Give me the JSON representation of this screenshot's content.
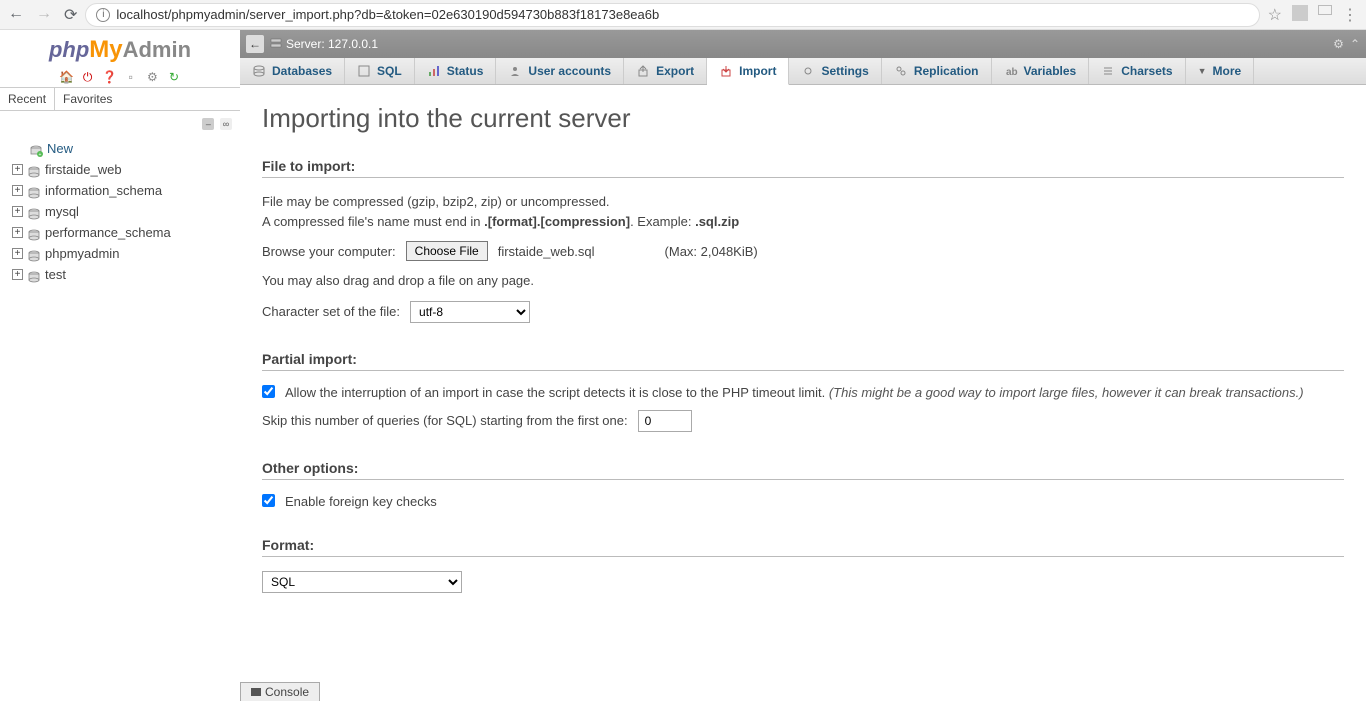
{
  "browser": {
    "url": "localhost/phpmyadmin/server_import.php?db=&token=02e630190d594730b883f18173e8ea6b"
  },
  "logo": {
    "part1": "php",
    "part2": "My",
    "part3": "Admin"
  },
  "sidebar": {
    "recent": "Recent",
    "favorites": "Favorites",
    "new": "New",
    "databases": [
      "firstaide_web",
      "information_schema",
      "mysql",
      "performance_schema",
      "phpmyadmin",
      "test"
    ]
  },
  "server_bar": {
    "label": "Server: 127.0.0.1"
  },
  "tabs": [
    "Databases",
    "SQL",
    "Status",
    "User accounts",
    "Export",
    "Import",
    "Settings",
    "Replication",
    "Variables",
    "Charsets",
    "More"
  ],
  "page": {
    "title": "Importing into the current server",
    "file_to_import": "File to import:",
    "compress_hint1": "File may be compressed (gzip, bzip2, zip) or uncompressed.",
    "compress_hint2a": "A compressed file's name must end in ",
    "compress_hint2b": ".[format].[compression]",
    "compress_hint2c": ". Example: ",
    "compress_hint2d": ".sql.zip",
    "browse_label": "Browse your computer:",
    "choose_file": "Choose File",
    "chosen_file": "firstaide_web.sql",
    "max_size": "(Max: 2,048KiB)",
    "dragdrop": "You may also drag and drop a file on any page.",
    "charset_label": "Character set of the file:",
    "charset_value": "utf-8",
    "partial_import": "Partial import:",
    "allow_interrupt": "Allow the interruption of an import in case the script detects it is close to the PHP timeout limit. ",
    "allow_interrupt_hint": "(This might be a good way to import large files, however it can break transactions.)",
    "skip_label": "Skip this number of queries (for SQL) starting from the first one:",
    "skip_value": "0",
    "other_options": "Other options:",
    "fk_checks": "Enable foreign key checks",
    "format": "Format:",
    "format_value": "SQL",
    "console": "Console"
  }
}
